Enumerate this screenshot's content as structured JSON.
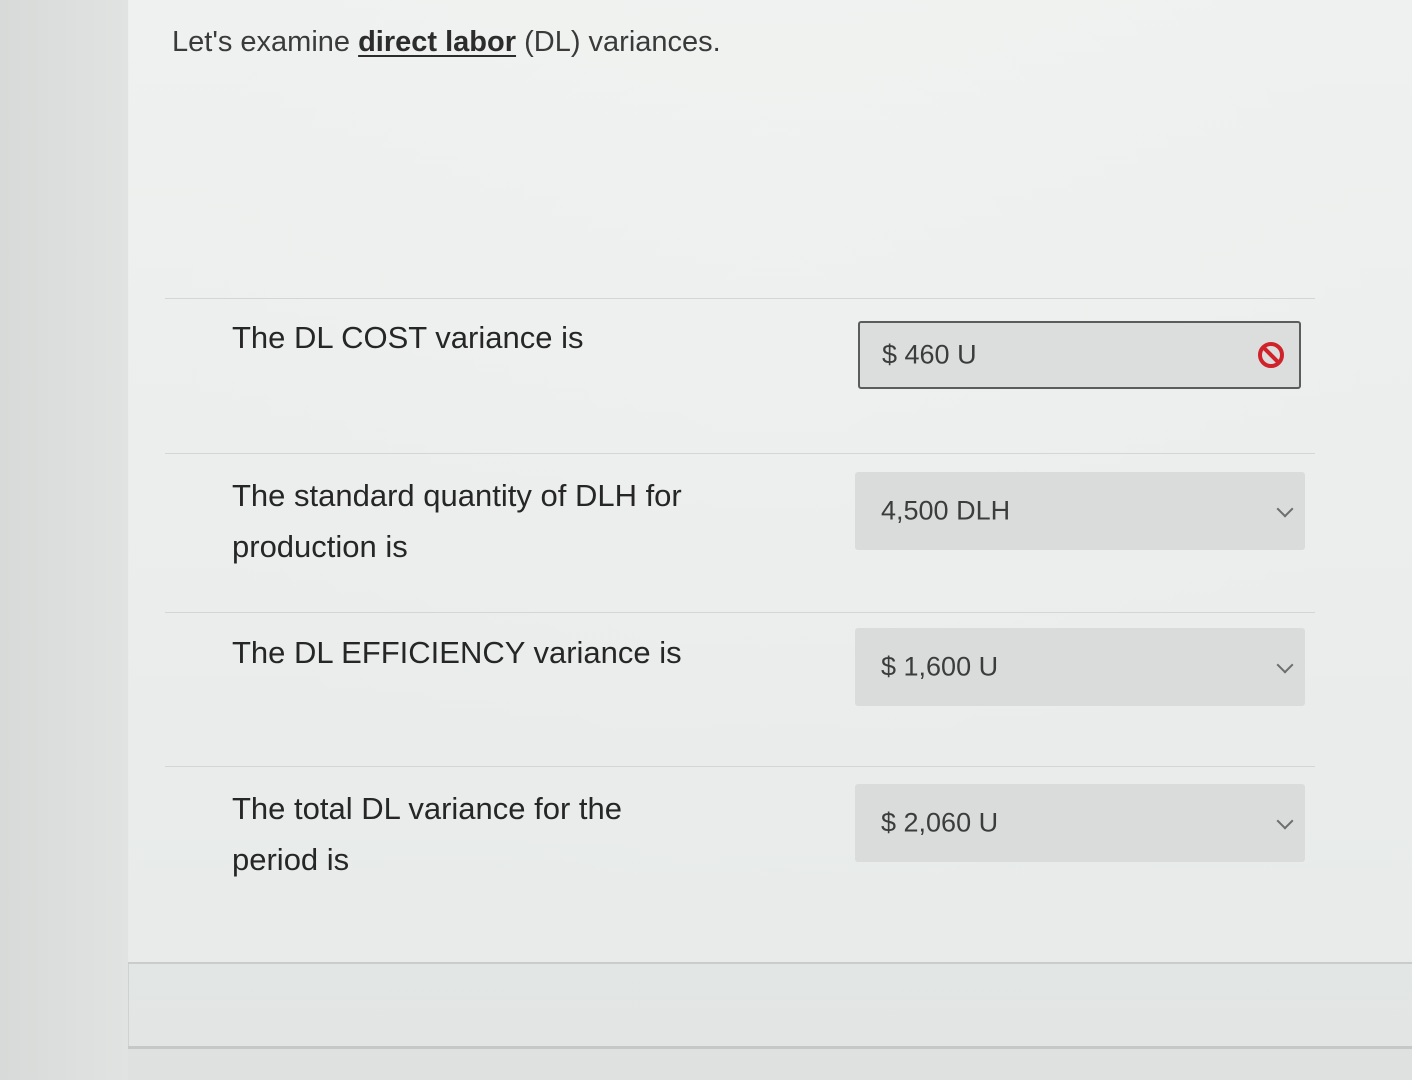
{
  "intro": {
    "prefix": "Let's examine ",
    "link": "direct labor",
    "suffix": " (DL) variances."
  },
  "questions": [
    {
      "label": "The DL COST variance is",
      "answer": "$ 460 U",
      "status": "incorrect",
      "icon": "no-entry-icon"
    },
    {
      "label": "The standard quantity of DLH for production is",
      "answer": "4,500 DLH",
      "icon": "chevron-down-icon"
    },
    {
      "label": "The DL EFFICIENCY variance is",
      "answer": "$ 1,600 U",
      "icon": "chevron-down-icon"
    },
    {
      "label": "The total DL variance for the period is",
      "answer": "$ 2,060 U",
      "icon": "chevron-down-icon"
    }
  ],
  "colors": {
    "incorrect": "#d0222a",
    "text": "#262626",
    "field": "#d9dcdb"
  }
}
